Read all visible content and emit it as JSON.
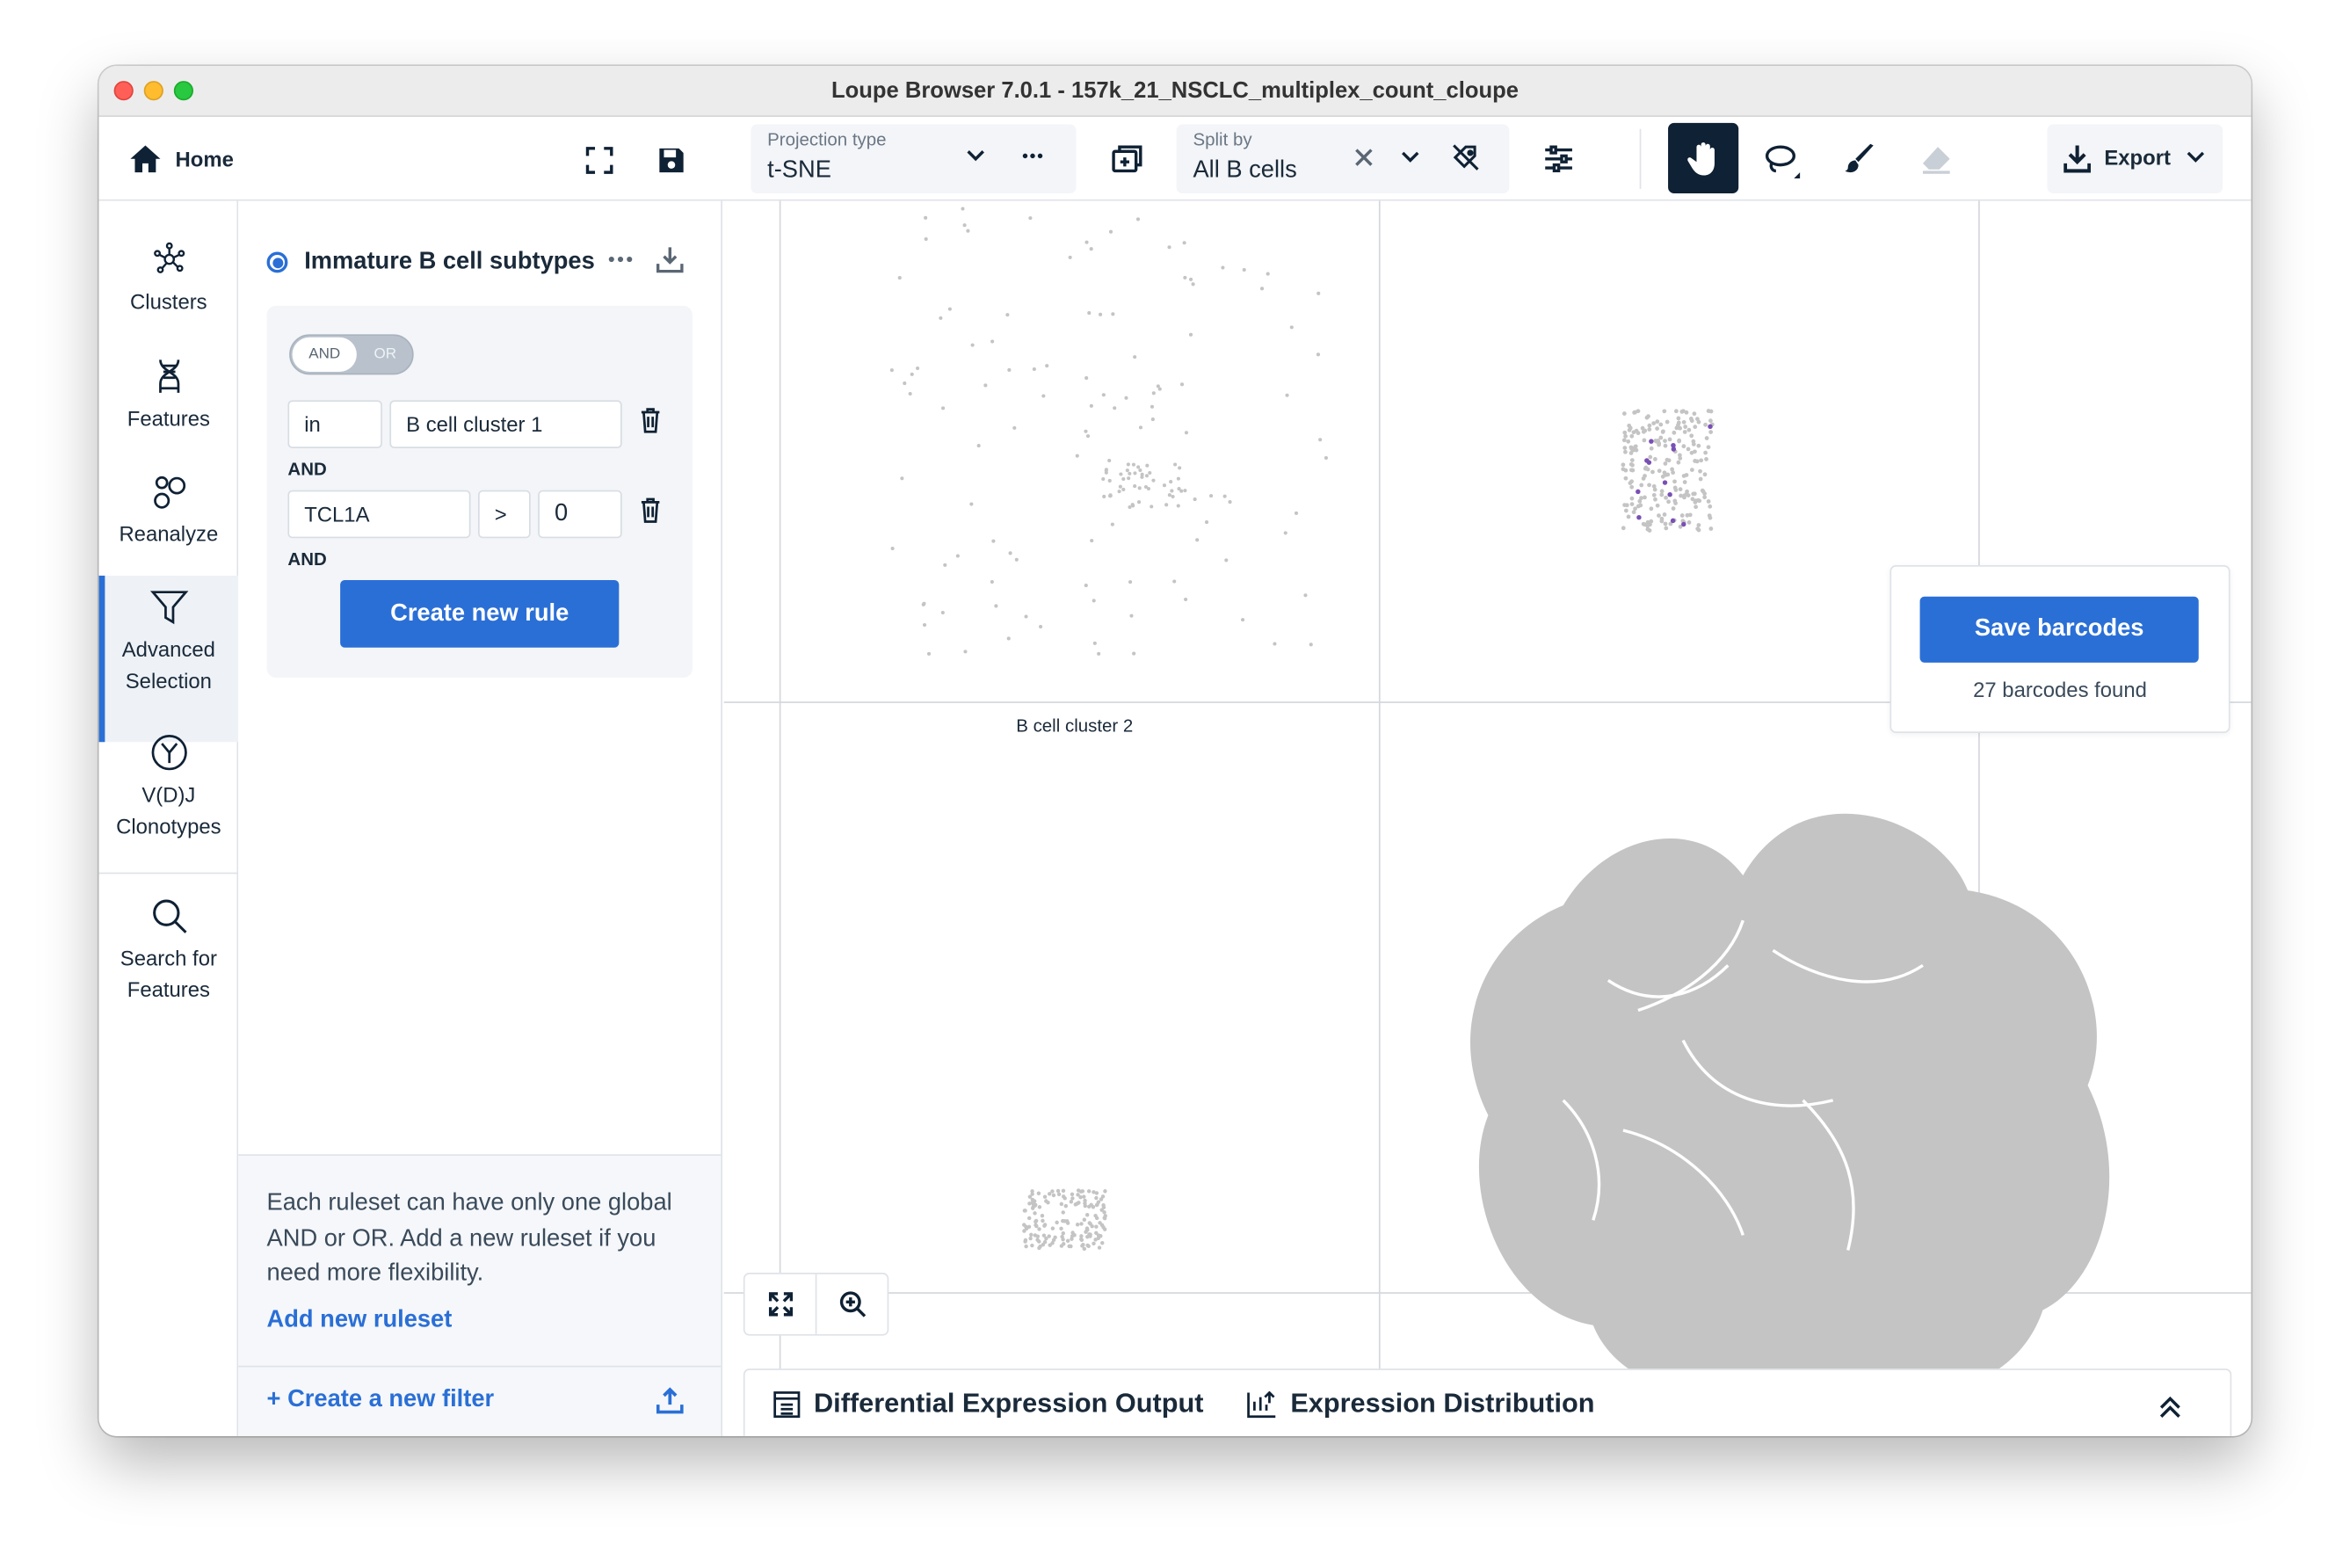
{
  "window": {
    "title": "Loupe Browser 7.0.1 - 157k_21_NSCLC_multiplex_count_cloupe"
  },
  "topbar": {
    "home_label": "Home",
    "projection": {
      "label": "Projection type",
      "value": "t-SNE"
    },
    "split": {
      "label": "Split by",
      "value": "All B cells"
    },
    "export_label": "Export"
  },
  "sidenav": {
    "items": [
      {
        "label": "Clusters",
        "icon": "clusters-icon"
      },
      {
        "label": "Features",
        "icon": "dna-icon"
      },
      {
        "label": "Reanalyze",
        "icon": "reanalyze-icon"
      },
      {
        "label1": "Advanced",
        "label2": "Selection",
        "icon": "funnel-icon",
        "active": true
      },
      {
        "label1": "V(D)J",
        "label2": "Clonotypes",
        "icon": "antibody-icon"
      },
      {
        "label1": "Search for",
        "label2": "Features",
        "icon": "search-icon"
      }
    ]
  },
  "panel": {
    "ruleset_title": "Immature B cell subtypes",
    "toggle": {
      "and": "AND",
      "or": "OR",
      "selected": "AND"
    },
    "rules": [
      {
        "op": "in",
        "value": "B cell cluster 1",
        "connector": "AND"
      },
      {
        "feature": "TCL1A",
        "comparator": ">",
        "value": "0",
        "connector": "AND"
      }
    ],
    "create_rule_label": "Create new rule",
    "help_text": "Each ruleset can have only one global AND or OR. Add a new ruleset if you need more flexibility.",
    "add_ruleset_label": "Add new ruleset",
    "create_filter_label": "+ Create a new filter"
  },
  "plot": {
    "panel_label": "B cell cluster 2",
    "save_button": "Save barcodes",
    "barcodes_found": "27 barcodes found"
  },
  "tabs": [
    {
      "label": "Differential Expression Output",
      "active": true
    },
    {
      "label": "Expression Distribution",
      "active": false
    }
  ],
  "colors": {
    "accent": "#2a6fd6",
    "dark": "#0f2134",
    "cell": "#c4c4c4",
    "highlight": "#7a4fb5"
  }
}
